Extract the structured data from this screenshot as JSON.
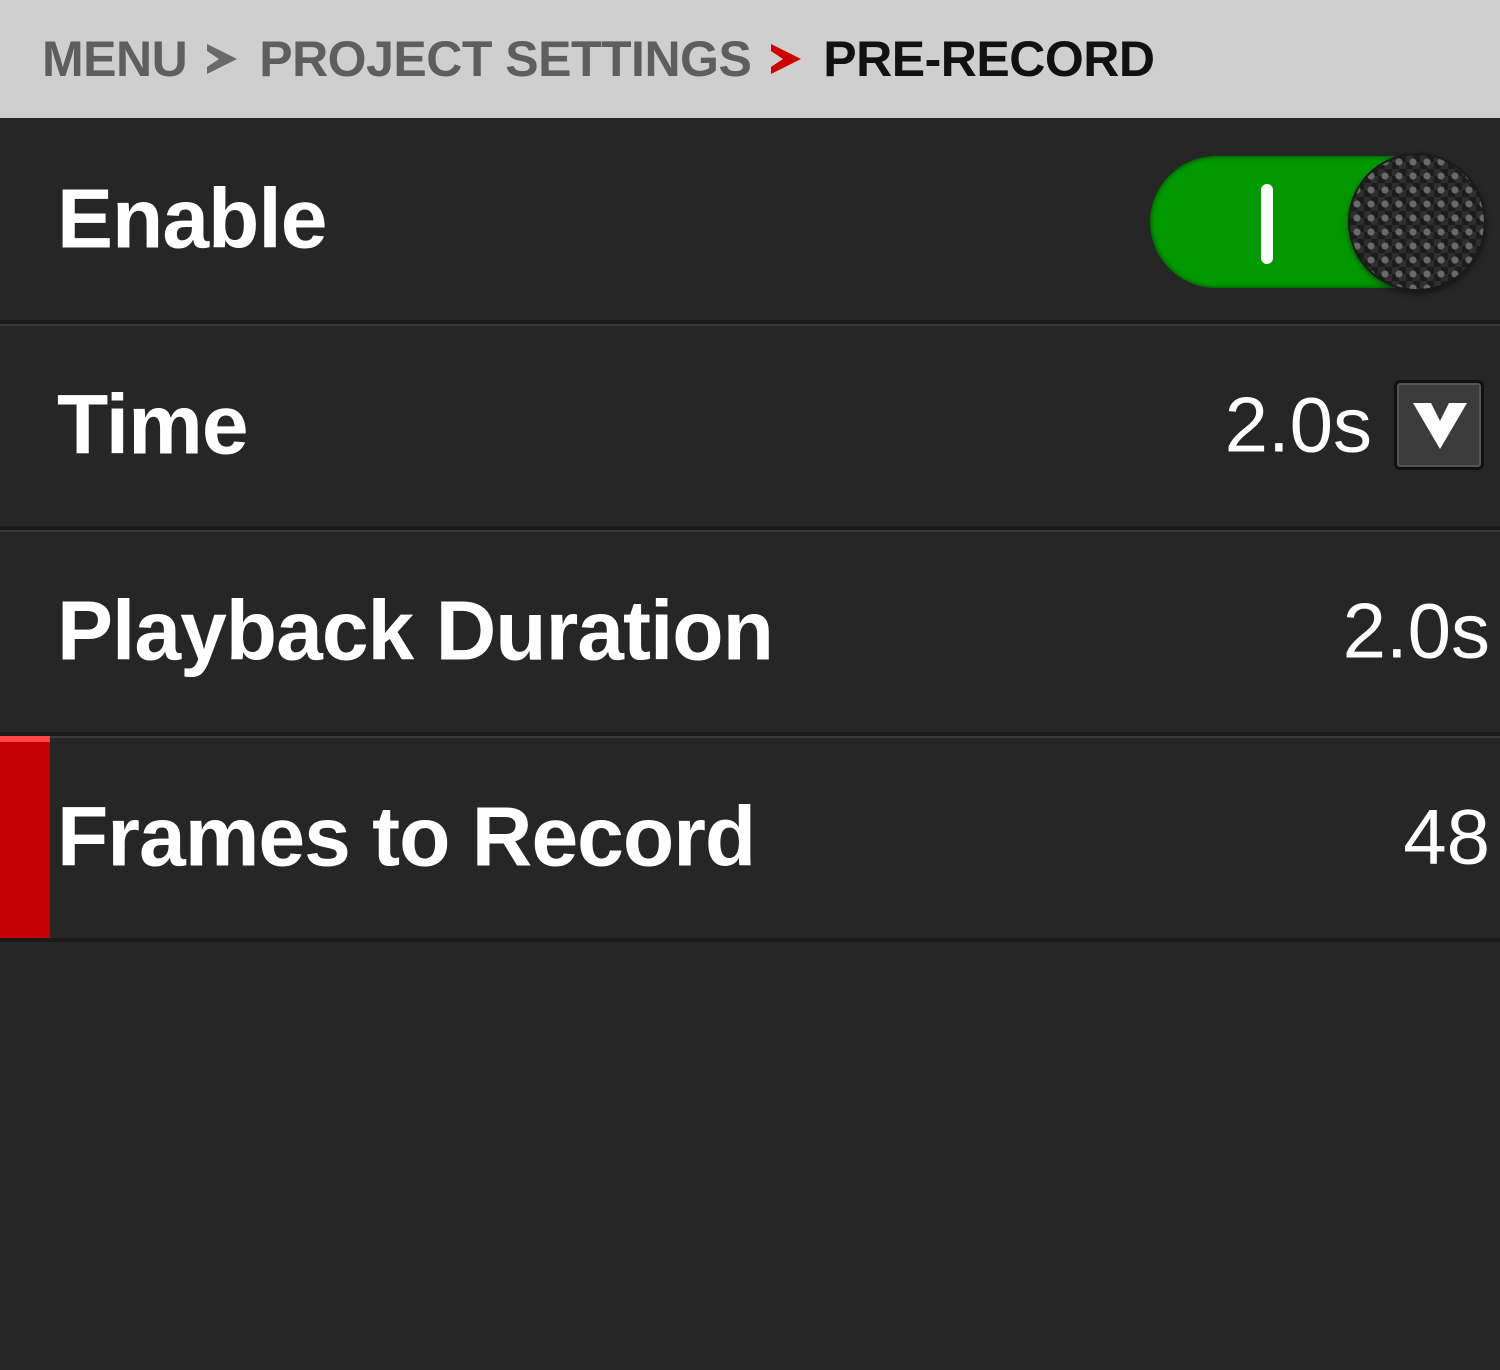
{
  "breadcrumb": {
    "items": [
      "MENU",
      "PROJECT SETTINGS"
    ],
    "current": "PRE-RECORD"
  },
  "colors": {
    "accent": "#d10000",
    "toggle_on": "#009a00",
    "background": "#262626",
    "header": "#cfcfcf"
  },
  "settings": {
    "enable": {
      "label": "Enable",
      "state": "on",
      "knob_icon": "toggle-knob-icon"
    },
    "time": {
      "label": "Time",
      "value": "2.0s",
      "dropdown_icon": "chevron-down-icon"
    },
    "playback_duration": {
      "label": "Playback Duration",
      "value": "2.0s"
    },
    "frames_to_record": {
      "label": "Frames to Record",
      "value": "48",
      "selected": true
    }
  }
}
